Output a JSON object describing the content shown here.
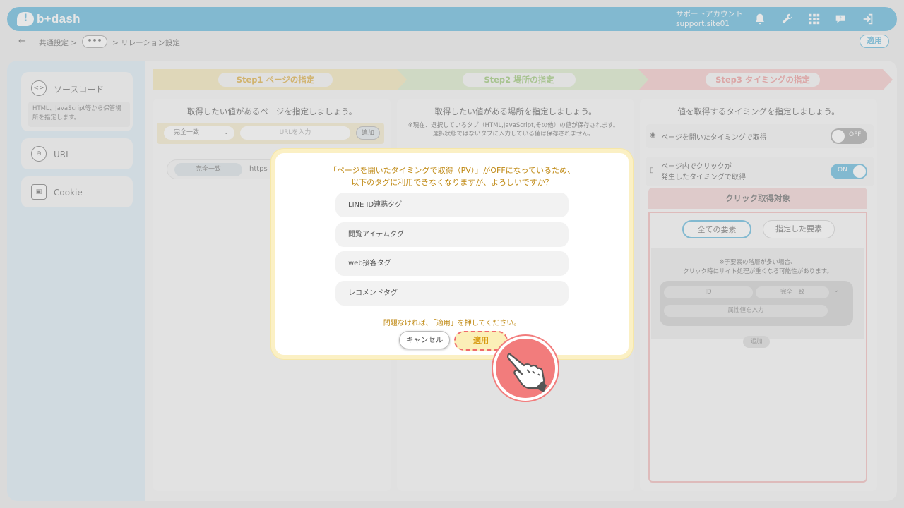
{
  "header": {
    "logo_text": "b+dash",
    "account_line1": "サポートアカウント",
    "account_line2": "support.site01"
  },
  "breadcrumb": {
    "back_glyph": "←",
    "item1": "共通設定 >",
    "more": "•••",
    "item3": "> リレーション設定",
    "apply_label": "適用"
  },
  "sidebar": {
    "items": [
      {
        "label": "ソースコード",
        "icon_glyph": "<>",
        "desc": "HTML、JavaScript等から保管場所を指定します。"
      },
      {
        "label": "URL",
        "icon_glyph": "⊖"
      },
      {
        "label": "Cookie",
        "icon_glyph": "▣"
      }
    ]
  },
  "steps": [
    {
      "label": "Step1 ページの指定"
    },
    {
      "label": "Step2 場所の指定"
    },
    {
      "label": "Step3 タイミングの指定"
    }
  ],
  "col1": {
    "title": "取得したい値があるページを指定しましょう。",
    "match_select": "完全一致",
    "url_placeholder": "URLを入力",
    "add_label": "追加",
    "row_match": "完全一致",
    "row_url": "https"
  },
  "col2": {
    "title": "取得したい値がある場所を指定しましょう。",
    "note_line1": "※現在、選択しているタブ（HTML,JavaScript,その他）の値が保存されます。",
    "note_line2": "選択状態ではないタブに入力している値は保存されません。"
  },
  "col3": {
    "title": "値を取得するタイミングを指定しましょう。",
    "pv_label": "ページを開いたタイミングで取得",
    "pv_toggle": "OFF",
    "click_label_line1": "ページ内でクリックが",
    "click_label_line2": "発生したタイミングで取得",
    "click_toggle": "ON",
    "click_target_title": "クリック取得対象",
    "all_elements": "全ての要素",
    "specified_elements": "指定した要素",
    "warn_line1": "※子要素の階層が多い場合、",
    "warn_line2": "クリック時にサイト処理が重くなる可能性があります。",
    "attr_select": "ID",
    "match_select": "完全一致",
    "attr_placeholder": "属性値を入力",
    "add_label": "追加"
  },
  "dialog": {
    "message_line1": "「ページを開いたタイミングで取得（PV）」がOFFになっているため、",
    "message_line2": "以下のタグに利用できなくなりますが、よろしいですか？",
    "tags": [
      "LINE ID連携タグ",
      "閲覧アイテムタグ",
      "web接客タグ",
      "レコメンドタグ"
    ],
    "note": "問題なければ、「適用」を押してください。",
    "cancel_label": "キャンセル",
    "apply_label": "適用"
  },
  "colors": {
    "brand": "#4aaed8",
    "step1": "#f3e3ad",
    "step2": "#d6e8c2",
    "step3": "#f4c2c2",
    "warning_text": "#c08a15",
    "pointer": "#f27c7c"
  }
}
